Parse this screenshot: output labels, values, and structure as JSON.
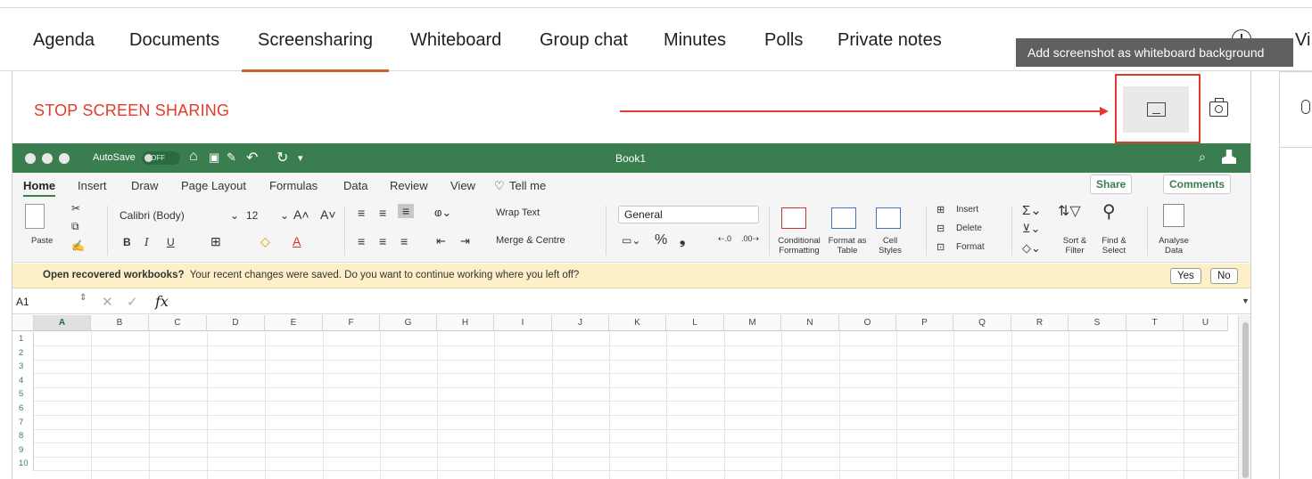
{
  "tabs": [
    {
      "label": "Agenda"
    },
    {
      "label": "Documents"
    },
    {
      "label": "Screensharing",
      "active": true
    },
    {
      "label": "Whiteboard"
    },
    {
      "label": "Group chat"
    },
    {
      "label": "Minutes"
    },
    {
      "label": "Polls"
    },
    {
      "label": "Private notes"
    }
  ],
  "truncated_tab": "Vi",
  "tooltip": "Add screenshot as whiteboard background",
  "stop_label": "STOP SCREEN SHARING",
  "colors": {
    "accent": "#c9632a",
    "stop": "#e23b2a",
    "excel_green": "#3a7d4e"
  },
  "icons": [
    "add-icon",
    "screen-background-icon",
    "camera-icon",
    "mic-icon"
  ],
  "excel": {
    "autosave": "AutoSave",
    "toggle": "OFF",
    "book": "Book1",
    "menu": [
      "Home",
      "Insert",
      "Draw",
      "Page Layout",
      "Formulas",
      "Data",
      "Review",
      "View",
      "Tell me"
    ],
    "share": "Share",
    "comments": "Comments",
    "ribbon": {
      "paste": "Paste",
      "font": "Calibri (Body)",
      "size": "12",
      "wrap": "Wrap Text",
      "merge": "Merge & Centre",
      "number_format": "General",
      "conditional": "Conditional Formatting",
      "format_table": "Format as Table",
      "cell_styles": "Cell Styles",
      "insert": "Insert",
      "delete": "Delete",
      "format": "Format",
      "sort": "Sort & Filter",
      "find": "Find & Select",
      "analyse": "Analyse Data"
    },
    "banner": {
      "bold": "Open recovered workbooks?",
      "text": "Your recent changes were saved. Do you want to continue working where you left off?",
      "yes": "Yes",
      "no": "No"
    },
    "namebox": "A1",
    "fx": "fx",
    "columns": [
      "A",
      "B",
      "C",
      "D",
      "E",
      "F",
      "G",
      "H",
      "I",
      "J",
      "K",
      "L",
      "M",
      "N",
      "O",
      "P",
      "Q",
      "R",
      "S",
      "T",
      "U"
    ],
    "rows": [
      "1",
      "2",
      "3",
      "4",
      "5",
      "6",
      "7",
      "8",
      "9",
      "10"
    ]
  }
}
